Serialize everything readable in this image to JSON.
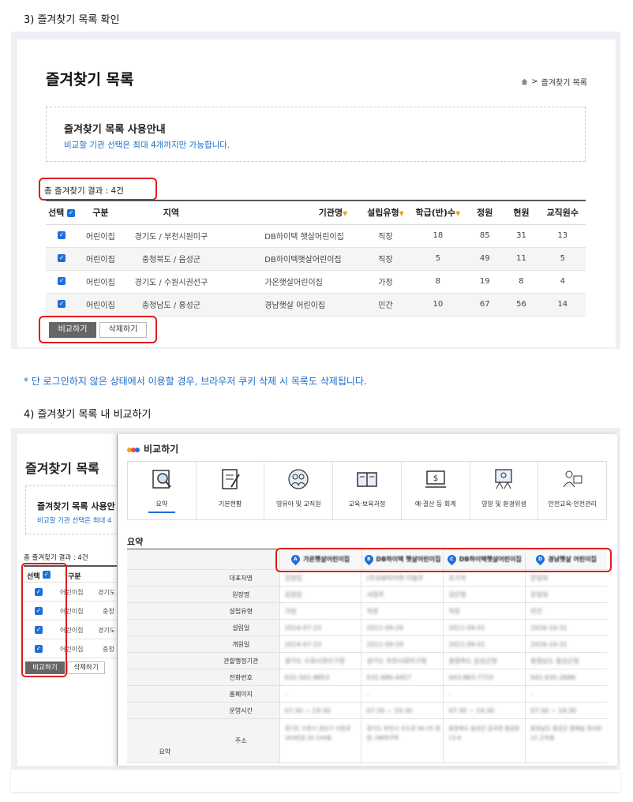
{
  "step3": {
    "heading": "3) 즐겨찾기 목록 확인"
  },
  "list": {
    "title": "즐겨찾기 목록",
    "breadcrumb": {
      "separator": ">",
      "current": "즐겨찾기 목록"
    },
    "guide_title": "즐겨찾기 목록 사용안내",
    "guide_desc": "비교할 기관 선택은 최대 4개까지만 가능합니다.",
    "total": "총 즐겨찾기 결과 : 4건",
    "columns": [
      "선택",
      "구분",
      "지역",
      "기관명",
      "설립유형",
      "학급(반)수",
      "정원",
      "현원",
      "교직원수"
    ],
    "rows": [
      {
        "type": "어린이집",
        "region": "경기도 / 부천시원미구",
        "name": "DB하이텍 햇살어린이집",
        "est": "직장",
        "classes": "18",
        "capacity": "85",
        "current": "31",
        "staff": "13"
      },
      {
        "type": "어린이집",
        "region": "충청북도 / 음성군",
        "name": "DB하이텍햇살어린이집",
        "est": "직장",
        "classes": "5",
        "capacity": "49",
        "current": "11",
        "staff": "5"
      },
      {
        "type": "어린이집",
        "region": "경기도 / 수원시권선구",
        "name": "가온햇살어린이집",
        "est": "가정",
        "classes": "8",
        "capacity": "19",
        "current": "8",
        "staff": "4"
      },
      {
        "type": "어린이집",
        "region": "충청남도 / 홍성군",
        "name": "경남햇살 어린이집",
        "est": "민간",
        "classes": "10",
        "capacity": "67",
        "current": "56",
        "staff": "14"
      }
    ],
    "compare_button": "비교하기",
    "delete_button": "삭제하기"
  },
  "notice": "* 단 로그인하지 않은 상태에서 이용할 경우, 브라우저 쿠키 삭제 시 목록도 삭제됩니다.",
  "step4": {
    "heading": "4) 즐겨찾기 목록 내 비교하기"
  },
  "background": {
    "title": "즐겨찾기 목록",
    "guide_title": "즐겨찾기 목록 사용안",
    "guide_desc": "비교할 기관 선택은 최대 4",
    "total": "총 즐겨찾기 결과 : 4건",
    "col_select": "선택",
    "col_type": "구분",
    "rows": [
      {
        "type": "어린이집",
        "region": "경기도"
      },
      {
        "type": "어린이집",
        "region": "충청"
      },
      {
        "type": "어린이집",
        "region": "경기도"
      },
      {
        "type": "어린이집",
        "region": "충청"
      }
    ],
    "compare_button": "비교하기",
    "delete_button": "삭제하기"
  },
  "modal": {
    "title": "비교하기",
    "tabs": [
      "요약",
      "기본현황",
      "영유아 및 교직원",
      "교육·보육과정",
      "예·결산 등 회계",
      "영양 및 환경위생",
      "안전교육·안전관리"
    ],
    "section": "요약",
    "facilities": [
      {
        "marker": "A",
        "name": "가온햇살어린이집"
      },
      {
        "marker": "B",
        "name": "DB하이텍 햇살어린이집"
      },
      {
        "marker": "C",
        "name": "DB하이텍햇살어린이집"
      },
      {
        "marker": "D",
        "name": "경남햇살 어린이집"
      }
    ],
    "group_label": "요약",
    "fields": [
      "대표자명",
      "원장명",
      "설립유형",
      "설립일",
      "개원일",
      "관할행정기관",
      "전화번호",
      "홈페이지",
      "운영시간",
      "주소"
    ],
    "values": [
      [
        "김정임",
        "(주)DB하이텍 이필주",
        "조기석",
        "문정희"
      ],
      [
        "김정임",
        "서영주",
        "김은영",
        "문정희"
      ],
      [
        "가정",
        "직장",
        "직장",
        "민간"
      ],
      [
        "2014-07-23",
        "2011-09-29",
        "2011-09-01",
        "2016-10-31"
      ],
      [
        "2014-07-23",
        "2011-09-29",
        "2011-09-01",
        "2016-10-31"
      ],
      [
        "경기도 수원시권선구청",
        "경기도 부천시원미구청",
        "충청북도 음성군청",
        "충청남도 홍성군청"
      ],
      [
        "031-502-8853",
        "032-680-4457",
        "043-883-7733",
        "041-635-2688"
      ],
      [
        "-",
        "-",
        "-",
        "-"
      ],
      [
        "07:30 ~ 19:30",
        "07:30 ~ 19:30",
        "07:30 ~ 19:30",
        "07:30 ~ 19:30"
      ],
      [
        "경기도 수원시 권선구 서둔로 163번길 20 104동",
        "경기도 부천시 수도로 90-35 동원, DB하이텍",
        "충청북도 음성군 감곡면 황금로 13-8",
        "충청남도 홍성군 홍북읍 청사로 15 근처동"
      ]
    ]
  }
}
